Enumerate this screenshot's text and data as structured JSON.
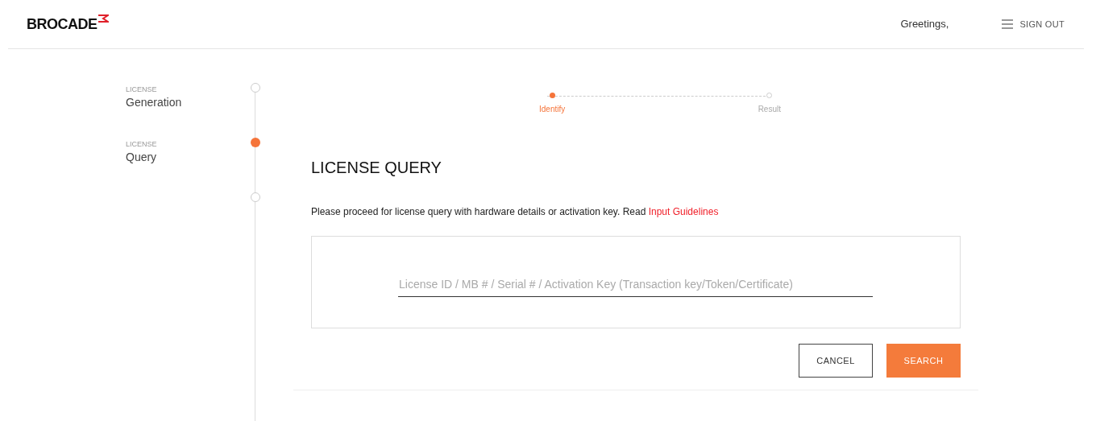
{
  "header": {
    "logo": "BROCADE",
    "greeting": "Greetings,",
    "sign_out": "SIGN OUT"
  },
  "sidebar": {
    "items": [
      {
        "caption": "LICENSE",
        "label": "Generation",
        "selected": false
      },
      {
        "caption": "LICENSE",
        "label": "Query",
        "selected": true
      },
      {
        "selected": false
      }
    ]
  },
  "stepper": [
    {
      "label": "Identify",
      "selected": true
    },
    {
      "label": "Result",
      "selected": false
    }
  ],
  "title": "LICENSE QUERY",
  "instructions": {
    "text": "Please proceed for license query with hardware details or activation key. Read",
    "link": "Input Guidelines"
  },
  "search_field": {
    "placeholder": "License ID / MB # / Serial # / Activation Key (Transaction key/Token/Certificate)"
  },
  "buttons": [
    {
      "label": "CANCEL",
      "kind": "outline"
    },
    {
      "label": "SEARCH",
      "kind": "primary"
    }
  ]
}
